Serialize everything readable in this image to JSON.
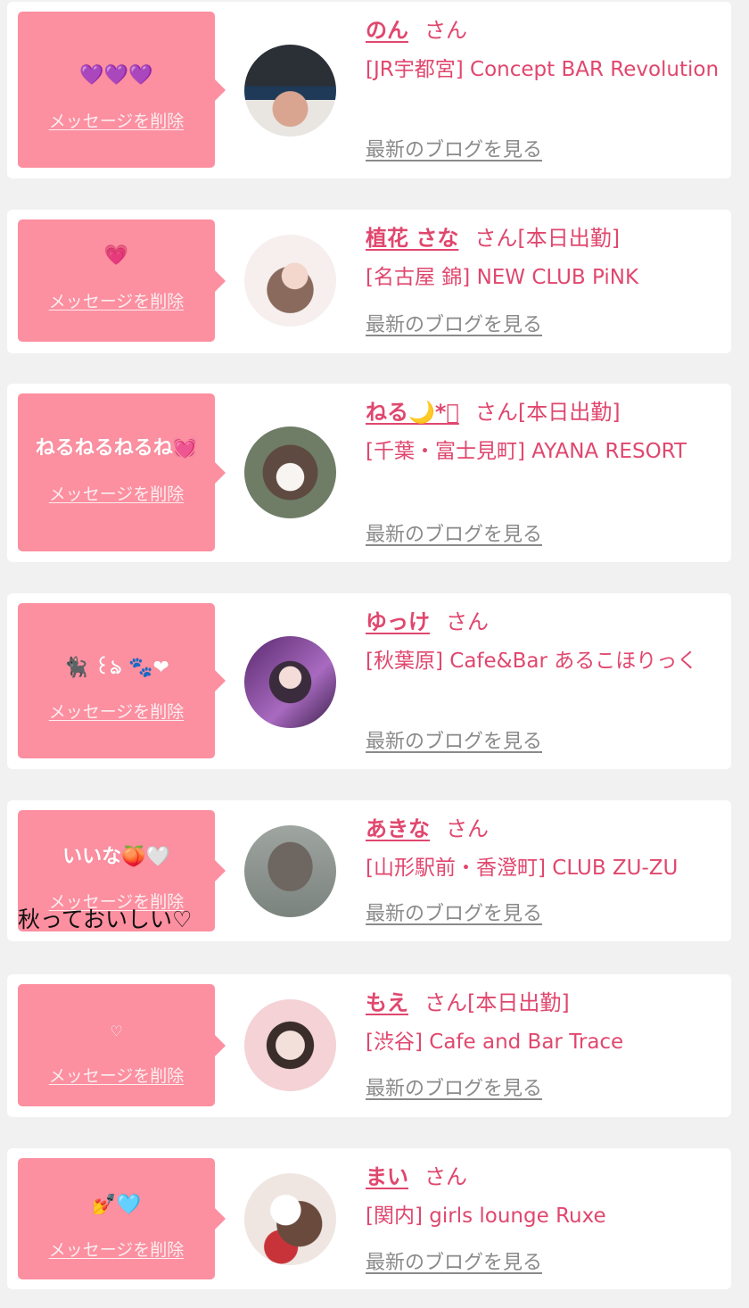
{
  "common": {
    "delete_label": "メッセージを削除",
    "blog_label": "最新のブログを見る"
  },
  "colors": {
    "accent_pink": "#fc8fa0",
    "name_pink": "#e0476e",
    "link_gray": "#8a8a8a",
    "background": "#f1f1f1"
  },
  "items": [
    {
      "message": "💜💜💜",
      "name": "のん",
      "honorific": "さん",
      "status": "",
      "shop": "[JR宇都宮] Concept BAR Revolution",
      "avatar": "person-with-bucket-hat-photo"
    },
    {
      "message": "💗",
      "name": "植花 さな",
      "honorific": "さん",
      "status": "[本日出勤]",
      "shop": "[名古屋 錦] NEW CLUB PiNK",
      "avatar": "woman-braided-hair-photo"
    },
    {
      "message": "ねるねるねるね💓",
      "name": "ねる🌙*ﾟ",
      "honorific": "さん",
      "status": "[本日出勤]",
      "shop": "[千葉・富士見町] AYANA RESORT",
      "avatar": "woman-face-hidden-photo"
    },
    {
      "message": "🐈‍⬛ ꒰ঌ 🐾❤",
      "name": "ゆっけ",
      "honorific": "さん",
      "status": "",
      "shop": "[秋葉原] Cafe&Bar あるこほりっく",
      "avatar": "woman-nurse-costume-photo"
    },
    {
      "message": "いいな🍑🤍",
      "name": "あきな",
      "honorific": "さん",
      "status": "",
      "shop": "[山形駅前・香澄町] CLUB ZU-ZU",
      "avatar": "braided-hair-back-photo"
    },
    {
      "message": "♡",
      "name": "もえ",
      "honorific": "さん",
      "status": "[本日出勤]",
      "shop": "[渋谷] Cafe and Bar Trace",
      "avatar": "woman-hearts-photo"
    },
    {
      "message": "💅🩵",
      "name": "まい",
      "honorific": "さん",
      "status": "",
      "shop": "[関内] girls lounge Ruxe",
      "avatar": "woman-hidden-face-photo"
    }
  ],
  "overlay_note": "秋っておいしい♡"
}
